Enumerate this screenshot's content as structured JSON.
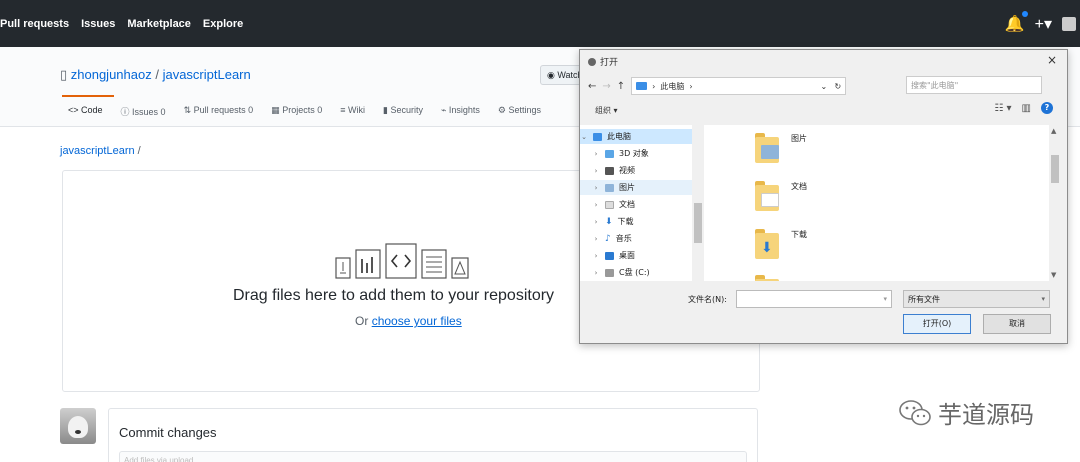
{
  "header": {
    "nav": [
      "Pull requests",
      "Issues",
      "Marketplace",
      "Explore"
    ],
    "icons": [
      "bell-icon",
      "plus-icon",
      "avatar-icon"
    ]
  },
  "repo": {
    "owner": "zhongjunhaoz",
    "name": "javascriptLearn",
    "watch_label": "Watch",
    "tabs": [
      "Code",
      "Issues 0",
      "Pull requests 0",
      "Projects 0",
      "Wiki",
      "Security",
      "Insights",
      "Settings"
    ],
    "path": "javascriptLearn",
    "path_sep": "/"
  },
  "upload": {
    "drag_text": "Drag files here to add them to your repository",
    "or_text": "Or",
    "choose_link": "choose your files"
  },
  "commit": {
    "title": "Commit changes",
    "input_placeholder": "Add files via upload"
  },
  "dialog": {
    "title": "打开",
    "close": "×",
    "address": "此电脑",
    "search_placeholder": "搜索\"此电脑\"",
    "organize": "组织 ▾",
    "tree": [
      "此电脑",
      "3D 对象",
      "视频",
      "图片",
      "文档",
      "下载",
      "音乐",
      "桌面",
      "C盘 (C:)"
    ],
    "files": [
      "图片",
      "文档",
      "下载"
    ],
    "filename_label": "文件名(N):",
    "filetype": "所有文件",
    "open_button": "打开(O)",
    "cancel_button": "取消"
  },
  "watermark": {
    "text": "芋道源码"
  },
  "colors": {
    "header_bg": "#24292e",
    "link": "#0366d6",
    "tab_accent": "#e36209",
    "dialog_selected": "#cde8ff"
  }
}
